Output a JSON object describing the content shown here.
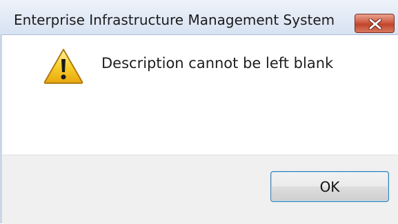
{
  "window": {
    "title": "Enterprise Infrastructure Management System",
    "close_icon": "close-icon"
  },
  "dialog": {
    "icon": "warning-icon",
    "message": "Description cannot be left blank",
    "ok_label": "OK"
  },
  "colors": {
    "close_button": "#c7462b",
    "warning_yellow": "#f5c518",
    "button_focus_border": "#3c7fb1"
  }
}
